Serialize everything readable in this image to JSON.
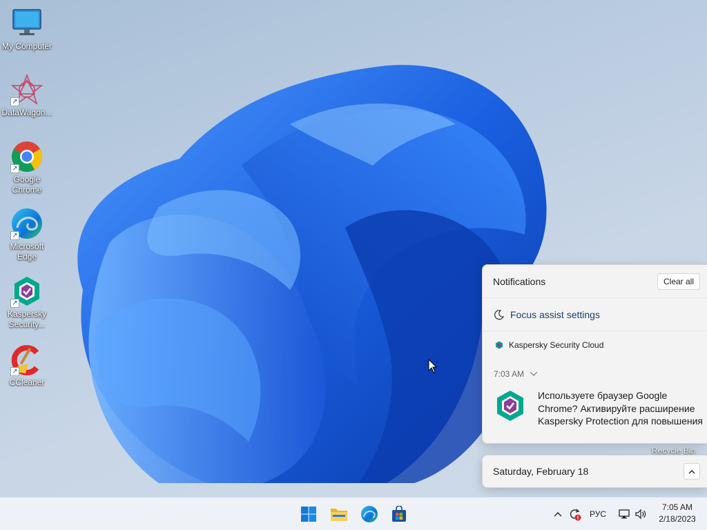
{
  "desktop": {
    "icons": [
      {
        "label": "My Computer",
        "icon": "monitor-icon"
      },
      {
        "label": "DataWagon...",
        "icon": "datawagon-icon"
      },
      {
        "label": "Google Chrome",
        "icon": "chrome-icon"
      },
      {
        "label": "Microsoft Edge",
        "icon": "edge-icon"
      },
      {
        "label": "Kaspersky Security...",
        "icon": "kaspersky-icon"
      },
      {
        "label": "CCleaner",
        "icon": "ccleaner-icon"
      }
    ],
    "recycle_bin_label": "Recycle Bin"
  },
  "notifications": {
    "title": "Notifications",
    "clear_all": "Clear all",
    "focus_assist": "Focus assist settings",
    "app_name": "Kaspersky Security Cloud",
    "time": "7:03 AM",
    "message": "Используете браузер Google Chrome? Активируйте расширение Kaspersky Protection для повышения"
  },
  "calendar": {
    "date": "Saturday, February 18"
  },
  "taskbar": {
    "apps": [
      "start-icon",
      "file-explorer-icon",
      "edge-icon",
      "store-icon"
    ],
    "language": "РУС",
    "time": "7:05 AM",
    "date": "2/18/2023"
  },
  "colors": {
    "wallpaper_blue": "#1a5fe0",
    "accent": "#0067c0",
    "kaspersky_green": "#00a88e"
  }
}
